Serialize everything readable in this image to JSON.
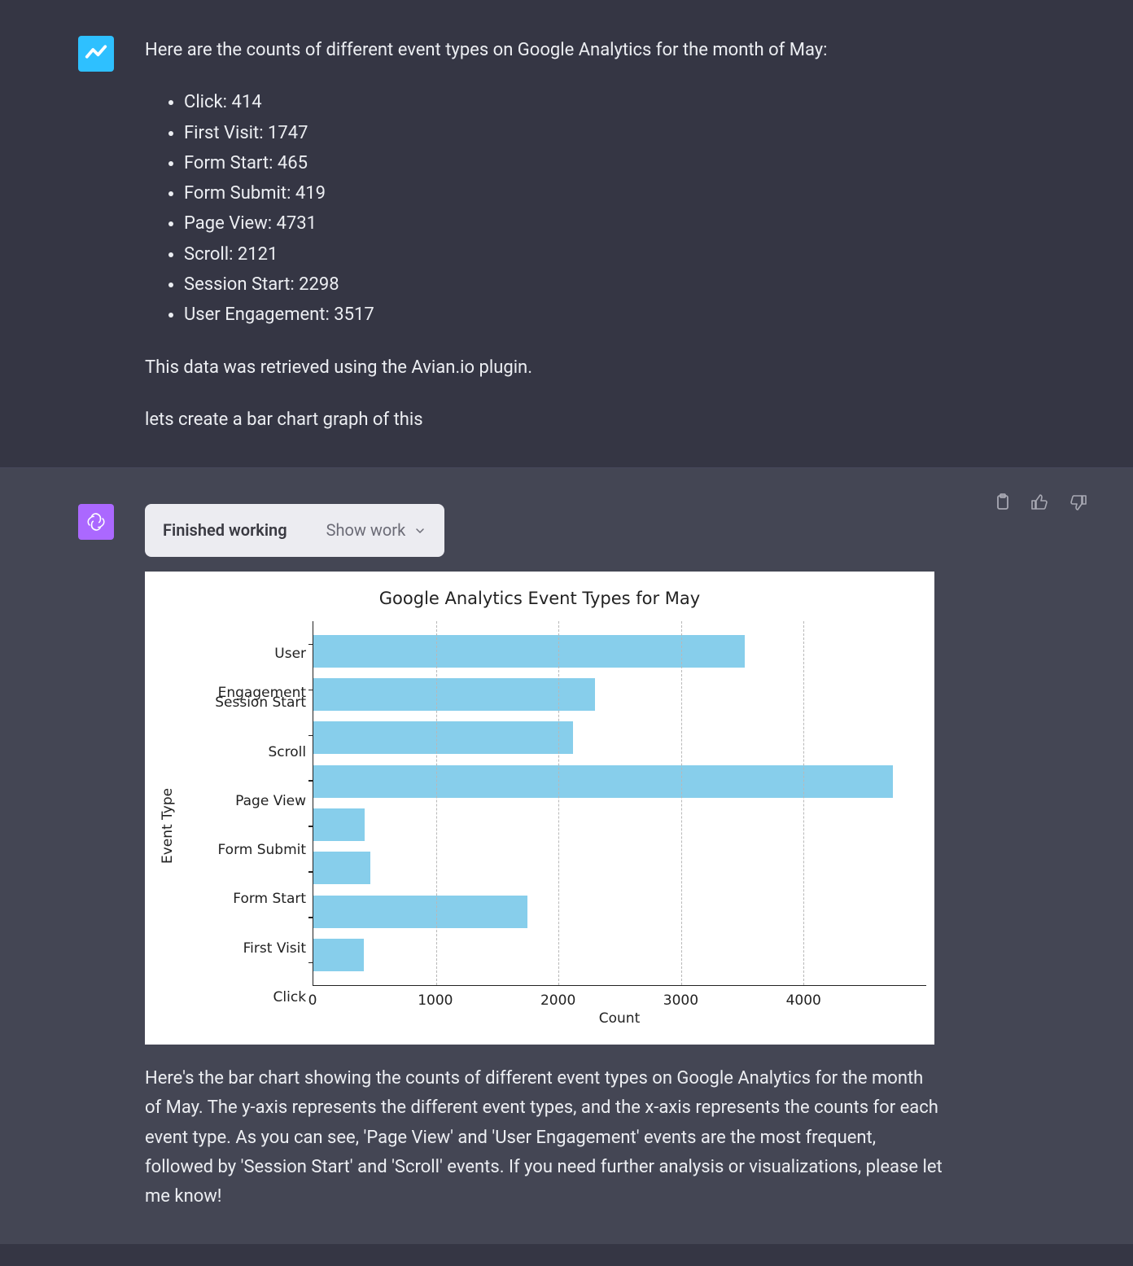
{
  "message1": {
    "intro": "Here are the counts of different event types on Google Analytics for the month of May:",
    "events": [
      "Click: 414",
      "First Visit: 1747",
      "Form Start: 465",
      "Form Submit: 419",
      "Page View: 4731",
      "Scroll: 2121",
      "Session Start: 2298",
      "User Engagement: 3517"
    ],
    "source": "This data was retrieved using the Avian.io plugin.",
    "followup": "lets create a bar chart graph of this"
  },
  "message2": {
    "pill_left": "Finished working",
    "pill_right": "Show work",
    "description": "Here's the bar chart showing the counts of different event types on Google Analytics for the month of May. The y-axis represents the different event types, and the x-axis represents the counts for each event type. As you can see, 'Page View' and 'User Engagement' events are the most frequent, followed by 'Session Start' and 'Scroll' events. If you need further analysis or visualizations, please let me know!"
  },
  "chart_data": {
    "type": "bar",
    "orientation": "horizontal",
    "title": "Google Analytics Event Types for May",
    "xlabel": "Count",
    "ylabel": "Event Type",
    "xlim": [
      0,
      5000
    ],
    "xticks": [
      0,
      1000,
      2000,
      3000,
      4000
    ],
    "categories": [
      "User Engagement",
      "Session Start",
      "Scroll",
      "Page View",
      "Form Submit",
      "Form Start",
      "First Visit",
      "Click"
    ],
    "values": [
      3517,
      2298,
      2121,
      4731,
      419,
      465,
      1747,
      414
    ],
    "bar_color": "#87ceeb"
  }
}
